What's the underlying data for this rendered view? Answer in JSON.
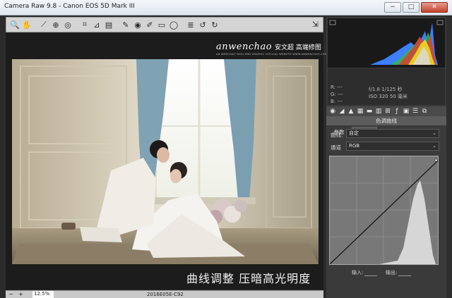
{
  "window": {
    "title": "Camera Raw 9.8 - Canon EOS 5D Mark III",
    "minimize": "−",
    "maximize": "□",
    "close": "✕"
  },
  "toolbar": {
    "tools": [
      "zoom-icon",
      "hand-icon",
      "white-balance-icon",
      "color-sampler-icon",
      "targeted-adjust-icon",
      "crop-icon",
      "straighten-icon",
      "transform-icon",
      "spot-removal-icon",
      "red-eye-icon",
      "adjustment-brush-icon",
      "graduated-filter-icon",
      "radial-filter-icon",
      "preferences-icon",
      "rotate-ccw-icon",
      "rotate-cw-icon"
    ],
    "glyphs": [
      "🔍",
      "✋",
      "⟋",
      "⊕",
      "◎",
      "⌗",
      "⊿",
      "▤",
      "✎",
      "◉",
      "✐",
      "▭",
      "◯",
      "≣",
      "↺",
      "↻"
    ]
  },
  "watermark": {
    "logo": "anwenchao",
    "chinese": "安文超 高端修图",
    "sub": "AN WENCHAO HIGH-END GRAPHIC OFFICIAL WEBSITE WWW.ANWENCHAO.COM"
  },
  "caption": "曲线调整 压暗高光明度",
  "bottombar": {
    "zoom": "12.5%",
    "filename": "2016E05E-C92"
  },
  "readout": {
    "r": "R:  ---",
    "g": "G:  ---",
    "b": "B:  ---",
    "exif_line1": "f/1.8    1/125 秒",
    "exif_line2": "ISO 320   50 毫米"
  },
  "panel": {
    "section_title": "色调曲线",
    "tab_params": "参数",
    "tab_point": "点",
    "curve_label": "曲线:",
    "curve_value": "自定",
    "channel_label": "通道",
    "channel_value": "RGB",
    "input_label": "输入:",
    "output_label": "输出:"
  },
  "colors": {
    "accent": "#3a3a3a",
    "canvas": "#1c1c1c",
    "curve_bg": "#787878"
  }
}
